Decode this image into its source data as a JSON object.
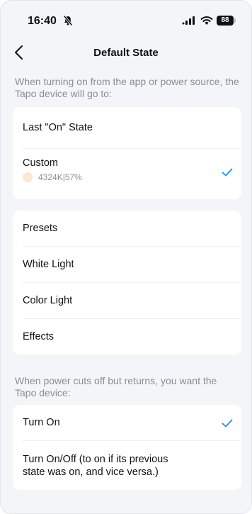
{
  "status_bar": {
    "time": "16:40",
    "battery": "88"
  },
  "header": {
    "title": "Default State"
  },
  "section1": {
    "note": "When turning on from the app or power source, the Tapo device will go to:",
    "last_on": "Last \"On\" State",
    "custom_label": "Custom",
    "custom_value": "4324K|57%"
  },
  "options": [
    "Presets",
    "White Light",
    "Color Light",
    "Effects"
  ],
  "section2": {
    "note": "When power cuts off but returns, you want the Tapo device:",
    "turn_on": "Turn On",
    "turn_on_off": "Turn On/Off (to on if its previous state was on, and vice versa.)"
  },
  "colors": {
    "accent": "#1a8cff",
    "swatch": "#fde6d2"
  },
  "icons": {
    "silent": "bell-slash-icon",
    "signal": "cellular-signal-icon",
    "wifi": "wifi-icon",
    "back": "chevron-left-icon",
    "check": "checkmark-icon"
  }
}
